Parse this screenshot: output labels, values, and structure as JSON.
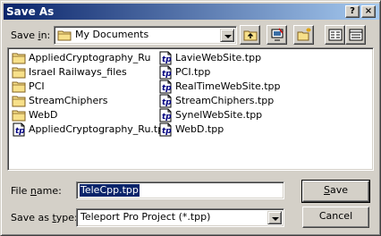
{
  "window": {
    "title": "Save As"
  },
  "title_buttons": {
    "help": "?",
    "close": "×"
  },
  "save_in": {
    "label_prefix": "Save ",
    "label_accel": "i",
    "label_suffix": "n:",
    "value": "My Documents"
  },
  "toolbar": {
    "up_icon": "up-folder-icon",
    "desktop_icon": "desktop-icon",
    "new_folder_icon": "new-folder-icon",
    "list_icon": "list-view-icon",
    "details_icon": "details-view-icon"
  },
  "files": {
    "column1": [
      {
        "name": "AppliedCryptography_Ru",
        "type": "folder"
      },
      {
        "name": "Israel Railways_files",
        "type": "folder"
      },
      {
        "name": "PCI",
        "type": "folder"
      },
      {
        "name": "StreamChiphers",
        "type": "folder"
      },
      {
        "name": "WebD",
        "type": "folder"
      },
      {
        "name": "AppliedCryptography_Ru.tpp",
        "type": "tpp"
      }
    ],
    "column2": [
      {
        "name": "LavieWebSite.tpp",
        "type": "tpp"
      },
      {
        "name": "PCI.tpp",
        "type": "tpp"
      },
      {
        "name": "RealTimeWebSite.tpp",
        "type": "tpp"
      },
      {
        "name": "StreamChiphers.tpp",
        "type": "tpp"
      },
      {
        "name": "SynelWebSite.tpp",
        "type": "tpp"
      },
      {
        "name": "WebD.tpp",
        "type": "tpp"
      }
    ]
  },
  "file_name": {
    "label_prefix": "File ",
    "label_accel": "n",
    "label_suffix": "ame:",
    "value": "TeleCpp.tpp"
  },
  "save_as_type": {
    "label_prefix": "Save as ",
    "label_accel": "t",
    "label_suffix": "ype:",
    "value": "Teleport Pro Project (*.tpp)"
  },
  "buttons": {
    "save_accel": "S",
    "save_rest": "ave",
    "cancel": "Cancel"
  }
}
